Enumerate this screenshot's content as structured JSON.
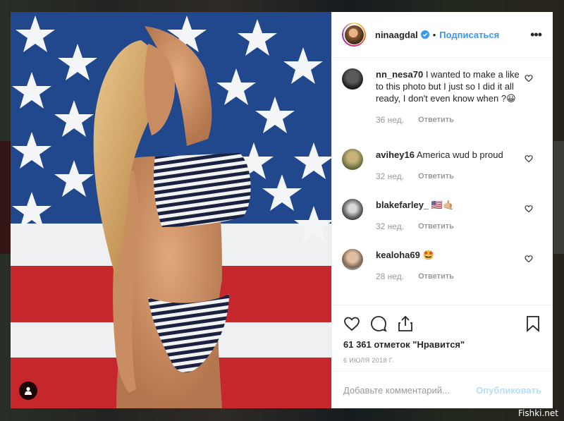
{
  "post": {
    "username": "ninaagdal",
    "follow_label": "Подписаться",
    "separator": "•",
    "more_label": "•••",
    "likes_text": "61 361 отметок \"Нравится\"",
    "date_text": "6 ИЮЛЯ 2018 Г."
  },
  "comments": [
    {
      "user": "nn_nesa70",
      "text": "I wanted to make a like to this photo but I just so I did it all ready, I don't even know when ?😀",
      "time": "36 нед.",
      "reply": "Ответить"
    },
    {
      "user": "avihey16",
      "text": "America wud b proud",
      "time": "32 нед.",
      "reply": "Ответить"
    },
    {
      "user": "blakefarley_",
      "text": "🇺🇸🤙🏼",
      "time": "32 нед.",
      "reply": "Ответить"
    },
    {
      "user": "kealoha69",
      "text": "🤩",
      "time": "28 нед.",
      "reply": "Ответить"
    }
  ],
  "composer": {
    "placeholder": "Добавьте комментарий...",
    "post_label": "Опубликовать"
  },
  "watermark": "Fishki.net",
  "colors": {
    "accent": "#3897f0",
    "post_disabled": "#b2dffc",
    "muted_text": "#999999",
    "flag_red": "#c8282e",
    "flag_blue": "#1f3f7e"
  },
  "icons": {
    "verified": "verified-badge-icon",
    "comment_like": "heart-outline-icon",
    "like": "heart-icon",
    "comment": "speech-bubble-icon",
    "share": "share-icon",
    "save": "bookmark-icon",
    "tag": "user-tag-icon"
  }
}
